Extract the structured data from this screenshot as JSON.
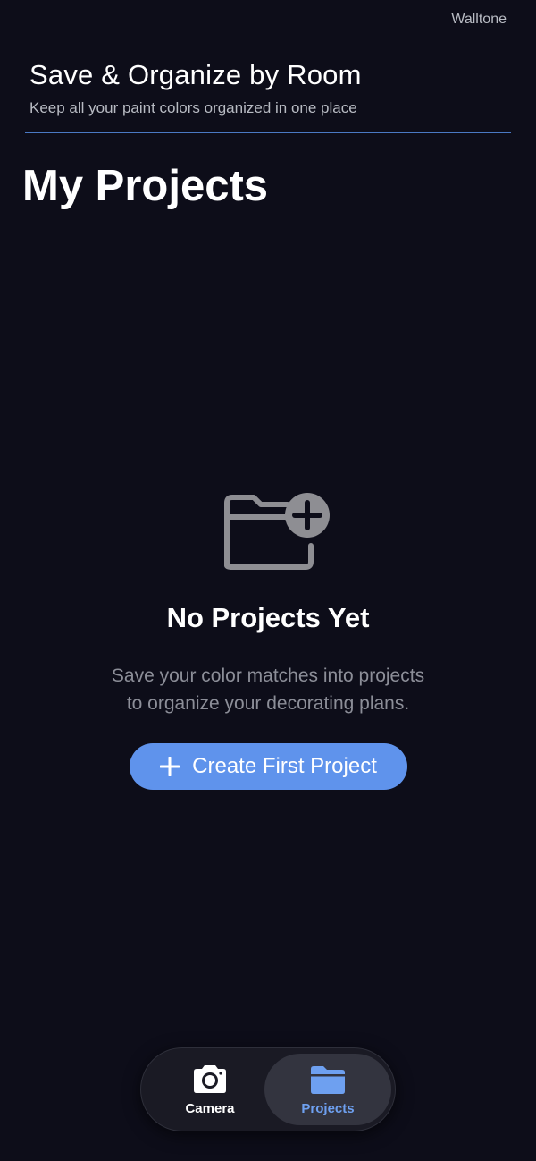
{
  "app": {
    "brand": "Walltone"
  },
  "header": {
    "title": "Save & Organize by Room",
    "subtitle": "Keep all your paint colors organized in one place"
  },
  "page": {
    "title": "My Projects"
  },
  "empty_state": {
    "icon": "folder-plus-icon",
    "title": "No Projects Yet",
    "description_lines": [
      "Save your color matches into projects",
      "to organize your decorating plans."
    ],
    "cta_label": "Create First Project",
    "cta_icon": "plus-icon"
  },
  "tabbar": {
    "active": "projects",
    "items": [
      {
        "id": "camera",
        "label": "Camera",
        "icon": "camera-icon"
      },
      {
        "id": "projects",
        "label": "Projects",
        "icon": "folder-icon"
      }
    ]
  },
  "colors": {
    "background": "#0d0d19",
    "accent": "#5f93ec",
    "divider": "#4a79c4",
    "muted_text": "#8c8e98",
    "icon_gray": "#8e8e93",
    "active_tab_label": "#6ea0f0"
  }
}
